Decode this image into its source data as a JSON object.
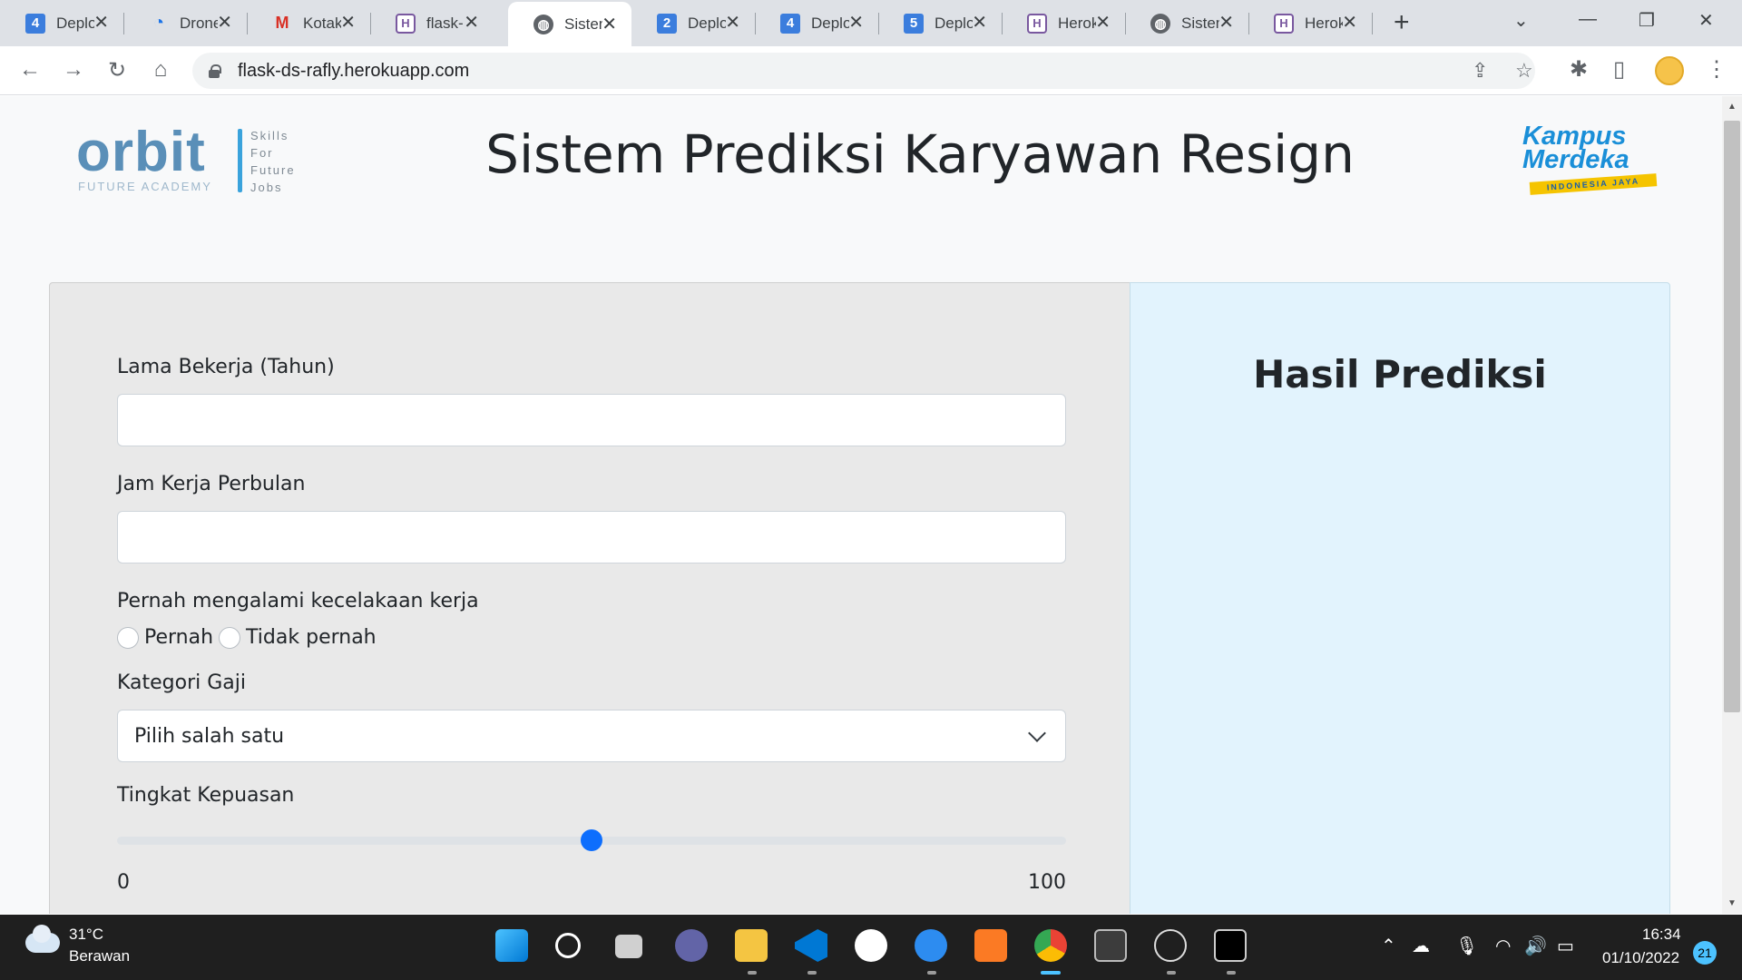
{
  "browser": {
    "tabs": [
      {
        "icon": "number-4-icon",
        "glyph": "4",
        "title": "Deploy"
      },
      {
        "icon": "drone-icon",
        "glyph": "",
        "title": "Drone"
      },
      {
        "icon": "gmail-icon",
        "glyph": "M",
        "title": "Kotak"
      },
      {
        "icon": "heroku-icon",
        "glyph": "H",
        "title": "flask-"
      },
      {
        "icon": "globe-icon",
        "glyph": "",
        "title": "Sistem"
      },
      {
        "icon": "number-2-icon",
        "glyph": "2",
        "title": "Deploy"
      },
      {
        "icon": "number-4-icon",
        "glyph": "4",
        "title": "Deploy"
      },
      {
        "icon": "number-5-icon",
        "glyph": "5",
        "title": "Deploy"
      },
      {
        "icon": "heroku-icon",
        "glyph": "H",
        "title": "Heroku"
      },
      {
        "icon": "globe-icon",
        "glyph": "",
        "title": "Sistem"
      },
      {
        "icon": "heroku-icon",
        "glyph": "H",
        "title": "Heroku"
      }
    ],
    "active_tab_index": 4,
    "url": "flask-ds-rafly.herokuapp.com"
  },
  "page": {
    "title": "Sistem Prediksi Karyawan Resign",
    "logo_left": {
      "brand": "orbit",
      "sub": "FUTURE ACADEMY",
      "tagline": [
        "Skills",
        "For",
        "Future",
        "Jobs"
      ]
    },
    "logo_right": {
      "line1": "Kampus",
      "line2": "Merdeka",
      "band": "INDONESIA JAYA"
    },
    "form": {
      "lama_label": "Lama Bekerja (Tahun)",
      "lama_value": "",
      "jam_label": "Jam Kerja Perbulan",
      "jam_value": "",
      "kecelakaan_label": "Pernah mengalami kecelakaan kerja",
      "radio_options": [
        "Pernah",
        "Tidak pernah"
      ],
      "gaji_label": "Kategori Gaji",
      "gaji_selected": "Pilih salah satu",
      "kepuasan_label": "Tingkat Kepuasan",
      "range_min": "0",
      "range_max": "100",
      "range_value": 50
    },
    "result": {
      "title": "Hasil Prediksi"
    }
  },
  "taskbar": {
    "temperature": "31°C",
    "weather": "Berawan",
    "time": "16:34",
    "date": "01/10/2022",
    "notifications": "21",
    "apps": [
      "windows-start-icon",
      "search-icon",
      "task-view-icon",
      "chat-icon",
      "file-explorer-icon",
      "vscode-icon",
      "github-icon",
      "help-icon",
      "xampp-icon",
      "chrome-icon",
      "terminal-icon",
      "obs-icon",
      "cmd-icon"
    ]
  },
  "colors": {
    "accent": "#0d6efd",
    "form_bg": "#e9e9e9",
    "result_bg": "#e2f3fd"
  }
}
